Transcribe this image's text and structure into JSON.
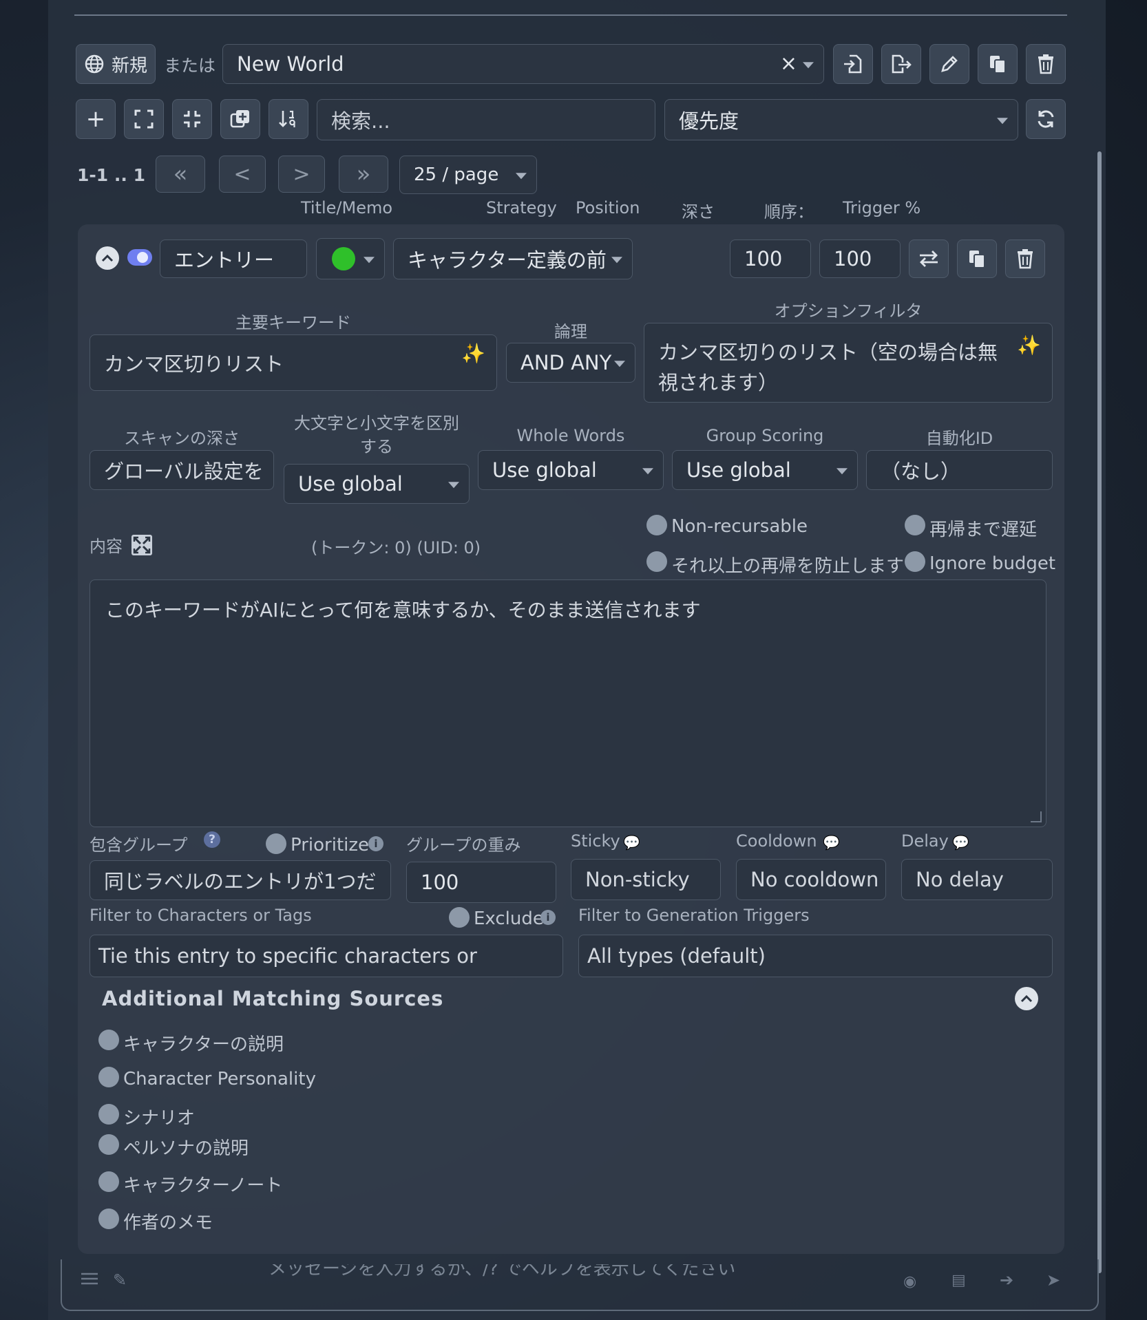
{
  "header": {
    "new_label": "新規",
    "or_label": "または",
    "world_value": "New World"
  },
  "toolbar": {
    "search_placeholder": "検索...",
    "sort_value": "優先度"
  },
  "pagination": {
    "range": "1-1 .. 1",
    "first": "«",
    "prev": "<",
    "next": ">",
    "last": "»",
    "per_page": "25 / page"
  },
  "columns": {
    "title_memo": "Title/Memo",
    "strategy": "Strategy",
    "position": "Position",
    "depth": "深さ",
    "order": "順序：",
    "trigger": "Trigger %"
  },
  "entry": {
    "title": "エントリー",
    "position_value": "キャラクター定義の前",
    "order_value": "100",
    "trigger_value": "100",
    "primary_keywords_label": "主要キーワード",
    "primary_keywords_placeholder": "カンマ区切りリスト",
    "logic_label": "論理",
    "logic_value": "AND ANY",
    "optional_filter_label": "オプションフィルタ",
    "optional_filter_placeholder_1": "カンマ区切りのリスト（空の場合は無",
    "optional_filter_placeholder_2": "視されます）",
    "scan_depth_label": "スキャンの深さ",
    "scan_depth_placeholder": "グローバル設定を",
    "case_label_1": "大文字と小文字を区別",
    "case_label_2": "する",
    "case_value": "Use global",
    "whole_words_label": "Whole Words",
    "whole_words_value": "Use global",
    "group_scoring_label": "Group Scoring",
    "group_scoring_value": "Use global",
    "automation_id_label": "自動化ID",
    "automation_id_placeholder": "（なし）",
    "content_label": "内容",
    "tokens_info": "(トークン:  0)  (UID: 0)",
    "non_recursable": "Non-recursable",
    "delay_until_recursion": "再帰まで遅延",
    "prevent_recursion": "それ以上の再帰を防止します",
    "ignore_budget": "Ignore budget",
    "content_placeholder": "このキーワードがAIにとって何を意味するか、そのまま送信されます",
    "inclusion_group_label": "包含グループ",
    "inclusion_group_placeholder": "同じラベルのエントリが1つだ",
    "prioritize_label": "Prioritize",
    "group_weight_label": "グループの重み",
    "group_weight_value": "100",
    "sticky_label": "Sticky",
    "sticky_placeholder": "Non-sticky",
    "cooldown_label": "Cooldown",
    "cooldown_placeholder": "No cooldown",
    "delay_label": "Delay",
    "delay_placeholder": "No delay",
    "filter_chars_label": "Filter to Characters or Tags",
    "exclude_label": "Exclude",
    "filter_chars_placeholder": "Tie this entry to specific characters or",
    "filter_triggers_label": "Filter to Generation Triggers",
    "filter_triggers_value": "All types (default)"
  },
  "additional_sources": {
    "title": "Additional Matching Sources",
    "items": [
      "キャラクターの説明",
      "Character Personality",
      "シナリオ",
      "ペルソナの説明",
      "キャラクターノート",
      "作者のメモ"
    ]
  },
  "bottom": {
    "input_placeholder": "メッセージを入力するか、/? でヘルプを表示してください"
  },
  "colors": {
    "status_dot": "#2fc02a",
    "toggle": "#6f7ff0",
    "sparkle": "#f0c850"
  }
}
